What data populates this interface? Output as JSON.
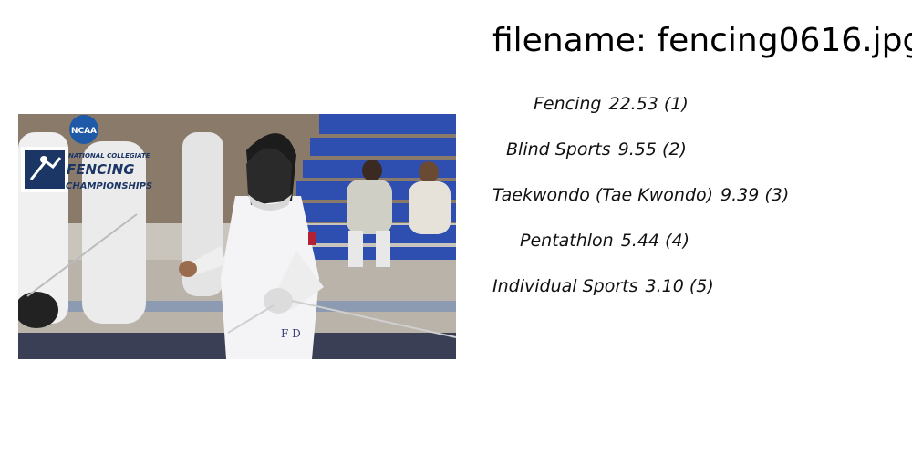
{
  "filename_label": "filename: fencing0616.jpg",
  "photo": {
    "logo": {
      "badge": "NCAA",
      "line1": "NATIONAL COLLEGIATE",
      "line2": "FENCING",
      "line3": "CHAMPIONSHIPS"
    },
    "jersey_letters": "F D"
  },
  "predictions": [
    {
      "label": "Fencing",
      "score": "22.53 (1)"
    },
    {
      "label": "Blind Sports",
      "score": "9.55 (2)"
    },
    {
      "label": "Taekwondo (Tae Kwondo)",
      "score": "9.39 (3)"
    },
    {
      "label": "Pentathlon",
      "score": "5.44 (4)"
    },
    {
      "label": "Individual Sports",
      "score": "3.10 (5)"
    }
  ]
}
